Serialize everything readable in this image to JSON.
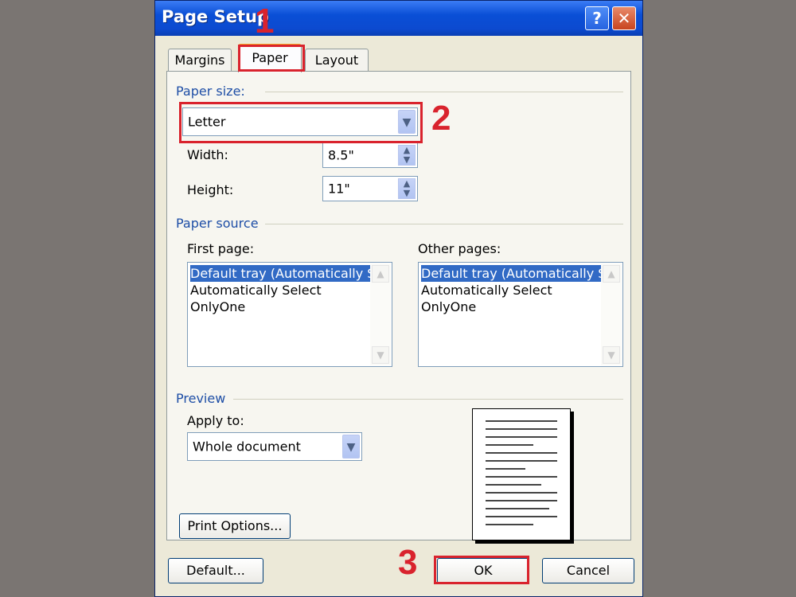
{
  "dialog": {
    "title": "Page Setup",
    "help_label": "?",
    "close_label": "✕"
  },
  "tabs": [
    {
      "label": "Margins"
    },
    {
      "label": "Paper",
      "active": true
    },
    {
      "label": "Layout"
    }
  ],
  "paper_size": {
    "group_label": "Paper size:",
    "selected": "Letter",
    "width_label": "Width:",
    "width_value": "8.5\"",
    "height_label": "Height:",
    "height_value": "11\""
  },
  "paper_source": {
    "group_label": "Paper source",
    "first_page_label": "First page:",
    "other_pages_label": "Other pages:",
    "first_page_items": [
      "Default tray (Automatically S",
      "Automatically Select",
      "OnlyOne"
    ],
    "other_pages_items": [
      "Default tray (Automatically S",
      "Automatically Select",
      "OnlyOne"
    ],
    "selected_index": 0
  },
  "preview": {
    "group_label": "Preview",
    "apply_to_label": "Apply to:",
    "apply_to_value": "Whole document"
  },
  "buttons": {
    "print_options": "Print Options...",
    "default": "Default...",
    "ok": "OK",
    "cancel": "Cancel"
  },
  "annotations": {
    "step1": "1",
    "step2": "2",
    "step3": "3",
    "color": "#d9232d"
  },
  "colors": {
    "title_bar": "#0a4fd6",
    "selection": "#316ac5",
    "group_label": "#1e4ea6",
    "background": "#7a7572"
  }
}
